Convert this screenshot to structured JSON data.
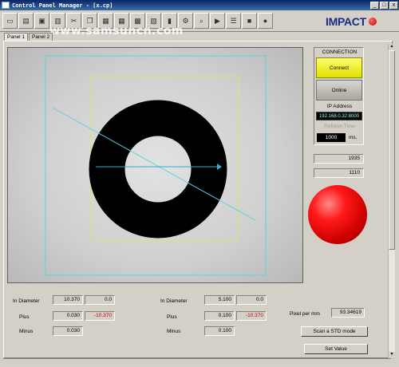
{
  "window": {
    "title": "Control Panel Manager - [x.cp]",
    "minimize": "_",
    "maximize": "□",
    "close": "x"
  },
  "toolbar": {
    "icons": [
      "new-icon",
      "open-icon",
      "save-icon",
      "print-icon",
      "cut-icon",
      "copy-icon",
      "paste-icon",
      "table-icon",
      "grid-icon",
      "image-icon",
      "delete-icon",
      "settings-icon",
      "find-icon",
      "run-icon",
      "list-icon",
      "stop-icon",
      "record-icon"
    ]
  },
  "brand": {
    "logo": "IMPACT"
  },
  "watermark": "www.samsuncn.com",
  "tabs": [
    {
      "label": "Panel 1"
    },
    {
      "label": "Panel 2"
    }
  ],
  "connection": {
    "title": "CONNECTION",
    "connect_label": "Connect",
    "online_label": "Online",
    "ip_label": "IP Address",
    "ip_value": "192.168.0.32:8000",
    "refresh_label": "Refresh Time",
    "refresh_value": "1000",
    "refresh_unit": "ms."
  },
  "readouts": {
    "value_1": "1935",
    "value_2": "1110"
  },
  "status_color": "#ff1a1a",
  "left_measure": {
    "in_diameter_label": "In Diameter",
    "in_diameter_value": "10.370",
    "in_diameter_aux": "0.0",
    "plus_label": "Plus",
    "plus_value": "0.030",
    "plus_aux": "-10.370",
    "minus_label": "Minus",
    "minus_value": "0.030"
  },
  "right_measure": {
    "in_diameter_label": "In Diameter",
    "in_diameter_value": "5.100",
    "in_diameter_aux": "0.0",
    "plus_label": "Plus",
    "plus_value": "0.100",
    "plus_aux": "-10.370",
    "minus_label": "Minus",
    "minus_value": "0.100"
  },
  "pixel": {
    "label": "Pixel per mm",
    "value": "93.34619"
  },
  "actions": {
    "scan_label": "Scan a STD mode",
    "set_label": "Set Value"
  }
}
